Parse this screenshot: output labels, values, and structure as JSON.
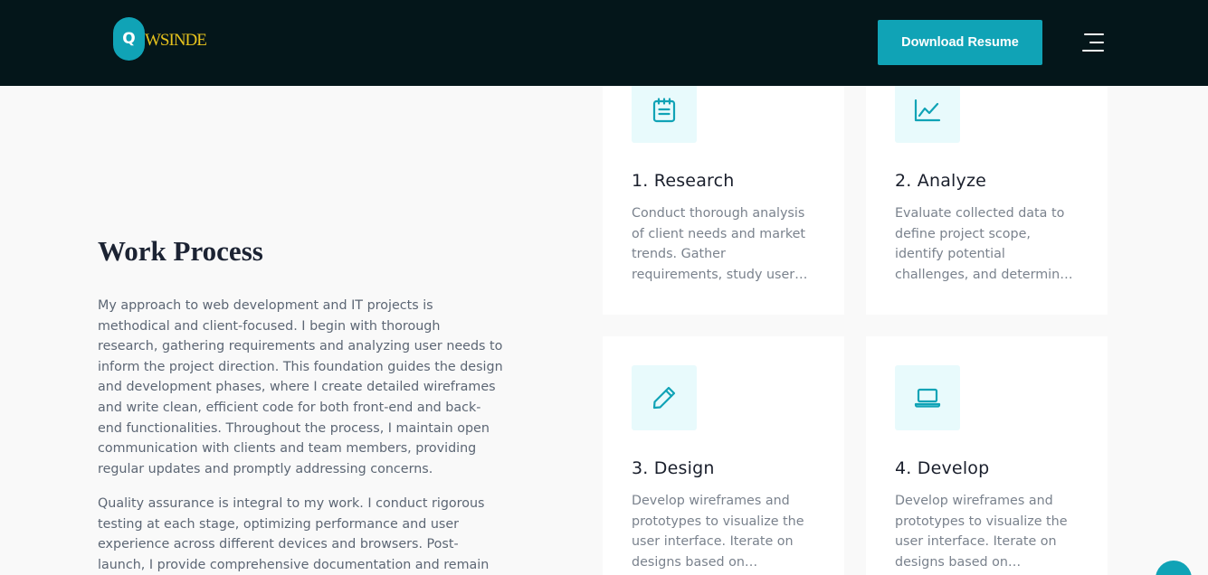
{
  "header": {
    "logo_letter": "Q",
    "logo_text": "WSINDE",
    "download_label": "Download Resume",
    "menu_icon": "hamburger-menu-icon"
  },
  "work_process": {
    "title": "Work Process",
    "paragraph_1": [
      "My approach to web development and IT projects is",
      "methodical and client-focused. I begin with thorough",
      "research, gathering requirements and analyzing user needs to",
      "inform the project direction. This foundation guides the design",
      "and development phases, where I create detailed wireframes",
      "and write clean, efficient code for both front-end and back-",
      "end functionalities. Throughout the process, I maintain open",
      "communication with clients and team members, providing",
      "regular updates and promptly addressing concerns."
    ],
    "paragraph_2": [
      "Quality assurance is integral to my work. I conduct rigorous",
      "testing at each stage, optimizing performance and user",
      "experience across different devices and browsers. Post-",
      "launch, I provide comprehensive documentation and remain"
    ]
  },
  "steps": [
    {
      "icon": "notepad-icon",
      "title": "1. Research",
      "lines": [
        "Conduct thorough analysis",
        "of client needs and market",
        "trends. Gather",
        "requirements, study user…"
      ]
    },
    {
      "icon": "chart-line-icon",
      "title": "2. Analyze",
      "lines": [
        "Evaluate collected data to",
        "define project scope,",
        "identify potential",
        "challenges, and determin…"
      ]
    },
    {
      "icon": "pencil-icon",
      "title": "3. Design",
      "lines": [
        "Develop wireframes and",
        "prototypes to visualize the",
        "user interface. Iterate on",
        "designs based on…"
      ]
    },
    {
      "icon": "laptop-icon",
      "title": "4. Develop",
      "lines": [
        "Develop wireframes and",
        "prototypes to visualize the",
        "user interface. Iterate on",
        "designs based on…"
      ]
    }
  ],
  "colors": {
    "header_bg": "#04161a",
    "accent": "#10a3b6",
    "logo_text": "#e6c21d",
    "icon_bg": "#e8fafc",
    "page_bg": "#f9f9f9"
  }
}
